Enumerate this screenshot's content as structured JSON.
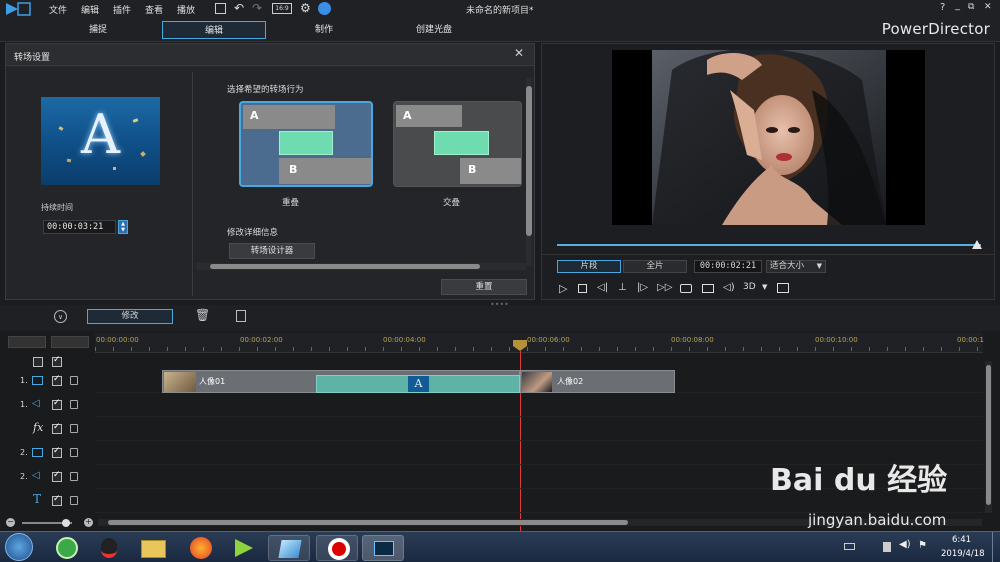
{
  "menu": [
    "文件",
    "编辑",
    "插件",
    "查看",
    "播放"
  ],
  "window_title": "未命名的新项目*",
  "window_controls": [
    "?",
    "_",
    "⧉",
    "✕"
  ],
  "modes": [
    {
      "label": "捕捉",
      "active": false
    },
    {
      "label": "编辑",
      "active": true
    },
    {
      "label": "制作",
      "active": false
    },
    {
      "label": "创建光盘",
      "active": false
    }
  ],
  "brand": "PowerDirector",
  "transition_panel": {
    "title": "转场设置",
    "duration_label": "持续时间",
    "duration_value": "00:00:03:21",
    "behavior_label": "选择希望的转场行为",
    "options": [
      {
        "label": "重叠",
        "a": "A",
        "b": "B",
        "selected": true
      },
      {
        "label": "交叠",
        "a": "A",
        "b": "B",
        "selected": false
      }
    ],
    "detail_label": "修改详细信息",
    "designer_button": "转场设计器",
    "reset_button": "重置",
    "thumb_letter": "A"
  },
  "preview": {
    "tab_clip": "片段",
    "tab_movie": "全片",
    "timecode": "00:00:02:21",
    "fit_label": "适合大小",
    "mode_3d": "3D",
    "progress": 0.99
  },
  "timeline_toolbar": {
    "modify_button": "修改"
  },
  "ruler": [
    "00:00:00:00",
    "00:00:02:00",
    "00:00:04:00",
    "00:00:06:00",
    "00:00:08:00",
    "00:00:10:00",
    "00:00:1"
  ],
  "tracks": [
    {
      "num": "1.",
      "kind": "video"
    },
    {
      "num": "1.",
      "kind": "audio"
    },
    {
      "num": "",
      "kind": "fx",
      "label": "fx"
    },
    {
      "num": "2.",
      "kind": "video"
    },
    {
      "num": "2.",
      "kind": "audio"
    },
    {
      "num": "",
      "kind": "title",
      "label": "T"
    }
  ],
  "clips": {
    "clip1": "人像01",
    "clip2": "人像02",
    "transition_letter": "A"
  },
  "taskbar": {
    "time": "6:41",
    "date": "2019/4/18"
  },
  "watermark": {
    "brand": "Bai du 经验",
    "url": "jingyan.baidu.com"
  },
  "colors": {
    "accent": "#4aa8e0",
    "clip_teal": "#5fb3a6",
    "playhead": "#e03a3a"
  }
}
